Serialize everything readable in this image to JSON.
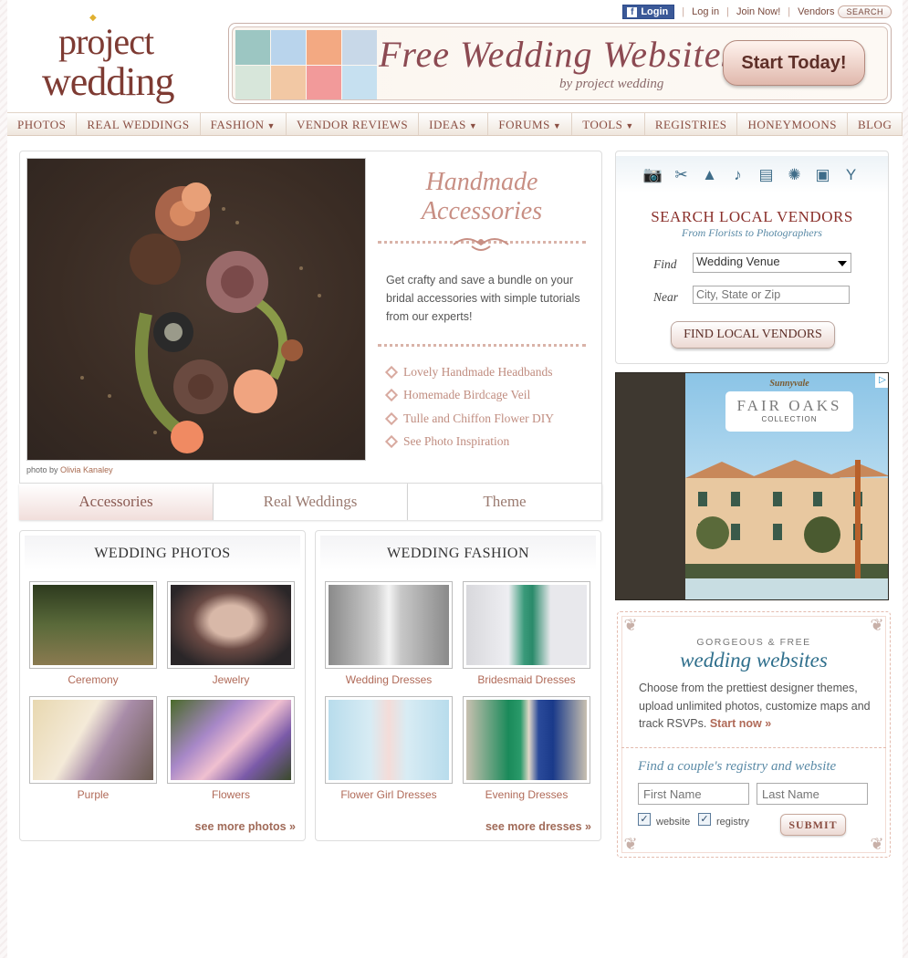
{
  "top_links": {
    "fb_login": "Login",
    "login": "Log in",
    "join": "Join Now!",
    "vendors": "Vendors",
    "search": "SEARCH"
  },
  "logo": {
    "line1": "project",
    "line2": "wedding"
  },
  "banner": {
    "title": "Free Wedding Websites",
    "subtitle": "by project wedding",
    "button": "Start Today!"
  },
  "nav": [
    {
      "label": "PHOTOS",
      "caret": false
    },
    {
      "label": "REAL WEDDINGS",
      "caret": false
    },
    {
      "label": "FASHION",
      "caret": true
    },
    {
      "label": "VENDOR REVIEWS",
      "caret": false
    },
    {
      "label": "IDEAS",
      "caret": true
    },
    {
      "label": "FORUMS",
      "caret": true
    },
    {
      "label": "TOOLS",
      "caret": true
    },
    {
      "label": "REGISTRIES",
      "caret": false
    },
    {
      "label": "HONEYMOONS",
      "caret": false
    },
    {
      "label": "BLOG",
      "caret": false
    }
  ],
  "feature": {
    "title_line1": "Handmade",
    "title_line2": "Accessories",
    "credit_prefix": "photo by",
    "credit_name": "Olivia Kanaley",
    "description": "Get crafty and save a bundle on your bridal accessories with simple tutorials from our experts!",
    "links": [
      "Lovely Handmade Headbands",
      "Homemade Birdcage Veil",
      "Tulle and Chiffon Flower DIY",
      "See Photo Inspiration"
    ],
    "tabs": [
      "Accessories",
      "Real Weddings",
      "Theme"
    ]
  },
  "photos": {
    "heading": "WEDDING PHOTOS",
    "items": [
      "Ceremony",
      "Jewelry",
      "Purple",
      "Flowers"
    ],
    "more": "see more photos »"
  },
  "fashion": {
    "heading": "WEDDING FASHION",
    "items": [
      "Wedding Dresses",
      "Bridesmaid Dresses",
      "Flower Girl Dresses",
      "Evening Dresses"
    ],
    "more": "see more dresses »"
  },
  "vendor_search": {
    "icons": [
      "camera-icon",
      "scissors-icon",
      "dress-icon",
      "music-note-icon",
      "cake-icon",
      "flower-icon",
      "video-camera-icon",
      "champagne-icon"
    ],
    "title": "SEARCH LOCAL VENDORS",
    "subtitle": "From Florists to Photographers",
    "find_label": "Find",
    "find_value": "Wedding Venue",
    "near_label": "Near",
    "near_placeholder": "City, State or Zip",
    "button": "FIND LOCAL VENDORS"
  },
  "ad": {
    "top": "Sunnyvale",
    "name": "FAIR OAKS",
    "collection": "COLLECTION",
    "adchoices": "▷"
  },
  "websites": {
    "kicker": "GORGEOUS & FREE",
    "title": "wedding websites",
    "description": "Choose from the prettiest designer themes, upload unlimited photos, customize maps and track RSVPs.",
    "start": "Start now »",
    "find": "Find a couple's registry and website",
    "first_placeholder": "First Name",
    "last_placeholder": "Last Name",
    "chk_website": "website",
    "chk_registry": "registry",
    "submit": "SUBMIT"
  }
}
